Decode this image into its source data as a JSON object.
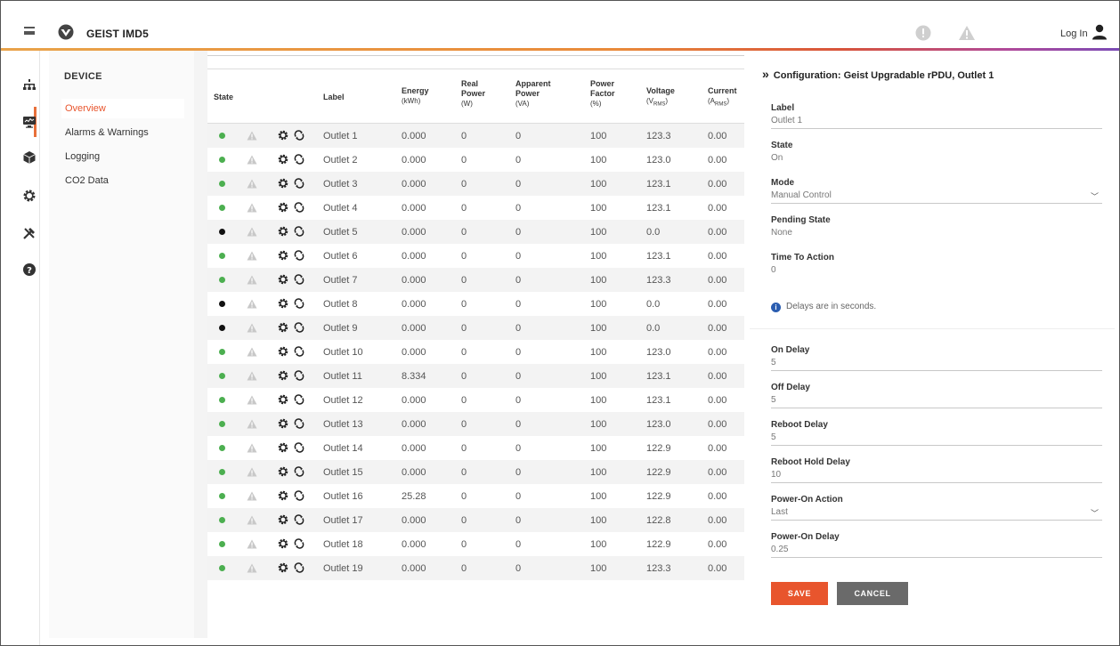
{
  "app": {
    "brand": "GEIST IMD5",
    "login_label": "Log In"
  },
  "subnav": {
    "title": "DEVICE",
    "items": [
      {
        "label": "Overview",
        "active": true
      },
      {
        "label": "Alarms & Warnings",
        "active": false
      },
      {
        "label": "Logging",
        "active": false
      },
      {
        "label": "CO2 Data",
        "active": false
      }
    ]
  },
  "table": {
    "headers": {
      "state": "State",
      "label": "Label",
      "energy": "Energy",
      "energy_unit": "(kWh)",
      "real_power_1": "Real",
      "real_power_2": "Power",
      "real_power_unit": "(W)",
      "apparent_power_1": "Apparent",
      "apparent_power_2": "Power",
      "apparent_power_unit": "(VA)",
      "power_factor_1": "Power",
      "power_factor_2": "Factor",
      "power_factor_unit": "(%)",
      "voltage": "Voltage",
      "voltage_unit": "(VRMS)",
      "current": "Current",
      "current_unit": "(ARMS)"
    },
    "rows": [
      {
        "state": "on",
        "label": "Outlet 1",
        "energy": "0.000",
        "real": "0",
        "apparent": "0",
        "pf": "100",
        "voltage": "123.3",
        "current": "0.00"
      },
      {
        "state": "on",
        "label": "Outlet 2",
        "energy": "0.000",
        "real": "0",
        "apparent": "0",
        "pf": "100",
        "voltage": "123.0",
        "current": "0.00"
      },
      {
        "state": "on",
        "label": "Outlet 3",
        "energy": "0.000",
        "real": "0",
        "apparent": "0",
        "pf": "100",
        "voltage": "123.1",
        "current": "0.00"
      },
      {
        "state": "on",
        "label": "Outlet 4",
        "energy": "0.000",
        "real": "0",
        "apparent": "0",
        "pf": "100",
        "voltage": "123.1",
        "current": "0.00"
      },
      {
        "state": "off",
        "label": "Outlet 5",
        "energy": "0.000",
        "real": "0",
        "apparent": "0",
        "pf": "100",
        "voltage": "0.0",
        "current": "0.00"
      },
      {
        "state": "on",
        "label": "Outlet 6",
        "energy": "0.000",
        "real": "0",
        "apparent": "0",
        "pf": "100",
        "voltage": "123.1",
        "current": "0.00"
      },
      {
        "state": "on",
        "label": "Outlet 7",
        "energy": "0.000",
        "real": "0",
        "apparent": "0",
        "pf": "100",
        "voltage": "123.3",
        "current": "0.00"
      },
      {
        "state": "off",
        "label": "Outlet 8",
        "energy": "0.000",
        "real": "0",
        "apparent": "0",
        "pf": "100",
        "voltage": "0.0",
        "current": "0.00"
      },
      {
        "state": "off",
        "label": "Outlet 9",
        "energy": "0.000",
        "real": "0",
        "apparent": "0",
        "pf": "100",
        "voltage": "0.0",
        "current": "0.00"
      },
      {
        "state": "on",
        "label": "Outlet 10",
        "energy": "0.000",
        "real": "0",
        "apparent": "0",
        "pf": "100",
        "voltage": "123.0",
        "current": "0.00"
      },
      {
        "state": "on",
        "label": "Outlet 11",
        "energy": "8.334",
        "real": "0",
        "apparent": "0",
        "pf": "100",
        "voltage": "123.1",
        "current": "0.00"
      },
      {
        "state": "on",
        "label": "Outlet 12",
        "energy": "0.000",
        "real": "0",
        "apparent": "0",
        "pf": "100",
        "voltage": "123.1",
        "current": "0.00"
      },
      {
        "state": "on",
        "label": "Outlet 13",
        "energy": "0.000",
        "real": "0",
        "apparent": "0",
        "pf": "100",
        "voltage": "123.0",
        "current": "0.00"
      },
      {
        "state": "on",
        "label": "Outlet 14",
        "energy": "0.000",
        "real": "0",
        "apparent": "0",
        "pf": "100",
        "voltage": "122.9",
        "current": "0.00"
      },
      {
        "state": "on",
        "label": "Outlet 15",
        "energy": "0.000",
        "real": "0",
        "apparent": "0",
        "pf": "100",
        "voltage": "122.9",
        "current": "0.00"
      },
      {
        "state": "on",
        "label": "Outlet 16",
        "energy": "25.28",
        "real": "0",
        "apparent": "0",
        "pf": "100",
        "voltage": "122.9",
        "current": "0.00"
      },
      {
        "state": "on",
        "label": "Outlet 17",
        "energy": "0.000",
        "real": "0",
        "apparent": "0",
        "pf": "100",
        "voltage": "122.8",
        "current": "0.00"
      },
      {
        "state": "on",
        "label": "Outlet 18",
        "energy": "0.000",
        "real": "0",
        "apparent": "0",
        "pf": "100",
        "voltage": "122.9",
        "current": "0.00"
      },
      {
        "state": "on",
        "label": "Outlet 19",
        "energy": "0.000",
        "real": "0",
        "apparent": "0",
        "pf": "100",
        "voltage": "123.3",
        "current": "0.00"
      }
    ]
  },
  "config": {
    "title": "Configuration: Geist Upgradable rPDU, Outlet 1",
    "fields": {
      "label": {
        "label": "Label",
        "value": "Outlet 1"
      },
      "state": {
        "label": "State",
        "value": "On"
      },
      "mode": {
        "label": "Mode",
        "value": "Manual Control"
      },
      "pending": {
        "label": "Pending State",
        "value": "None"
      },
      "tta": {
        "label": "Time To Action",
        "value": "0"
      },
      "on_delay": {
        "label": "On Delay",
        "value": "5"
      },
      "off_delay": {
        "label": "Off Delay",
        "value": "5"
      },
      "reboot_delay": {
        "label": "Reboot Delay",
        "value": "5"
      },
      "reboot_hold": {
        "label": "Reboot Hold Delay",
        "value": "10"
      },
      "power_on_action": {
        "label": "Power-On Action",
        "value": "Last"
      },
      "power_on_delay": {
        "label": "Power-On Delay",
        "value": "0.25"
      }
    },
    "info": "Delays are in seconds.",
    "save_label": "SAVE",
    "cancel_label": "CANCEL"
  },
  "colors": {
    "accent": "#e8552d",
    "on": "#4caf50",
    "off": "#111111",
    "cancel": "#6a6a6a"
  }
}
